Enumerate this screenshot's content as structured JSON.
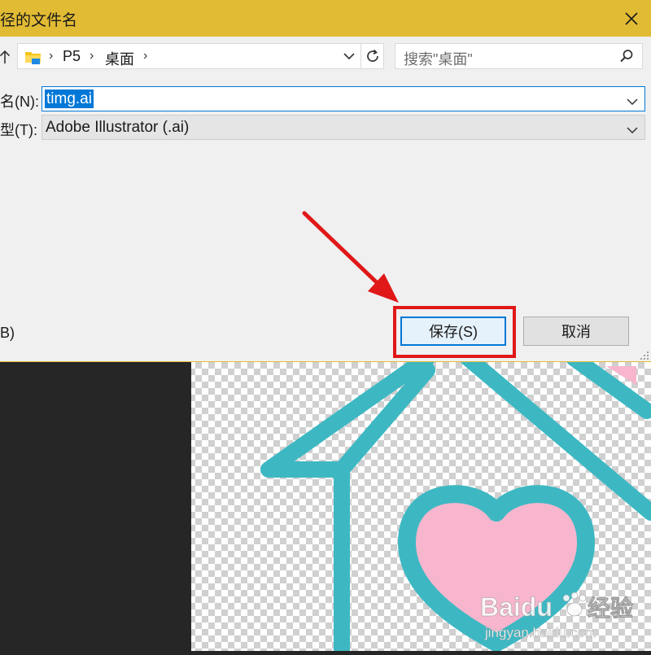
{
  "dialog": {
    "title": "径的文件名",
    "close_icon": "close-icon"
  },
  "address_bar": {
    "folder_icon": "folder-icon",
    "crumbs": [
      "P5",
      "桌面"
    ],
    "refresh_icon": "refresh-icon"
  },
  "search": {
    "placeholder": "搜索\"桌面\""
  },
  "file_name": {
    "label": "名(N):",
    "value": "timg.ai"
  },
  "file_type": {
    "label": "型(T):",
    "value": "Adobe Illustrator (.ai)"
  },
  "hide_folders": {
    "label": "B)"
  },
  "buttons": {
    "save_label": "保存(S)",
    "cancel_label": "取消"
  },
  "colors": {
    "title_bar": "#e2bb34",
    "accent": "#0078d7",
    "annotation": "#e01818",
    "artwork_teal": "#3db8c3",
    "artwork_pink": "#f7b6cd"
  },
  "watermark": {
    "brand": "Baidu",
    "product": "经验",
    "url": "jingyan.baidu.com"
  }
}
